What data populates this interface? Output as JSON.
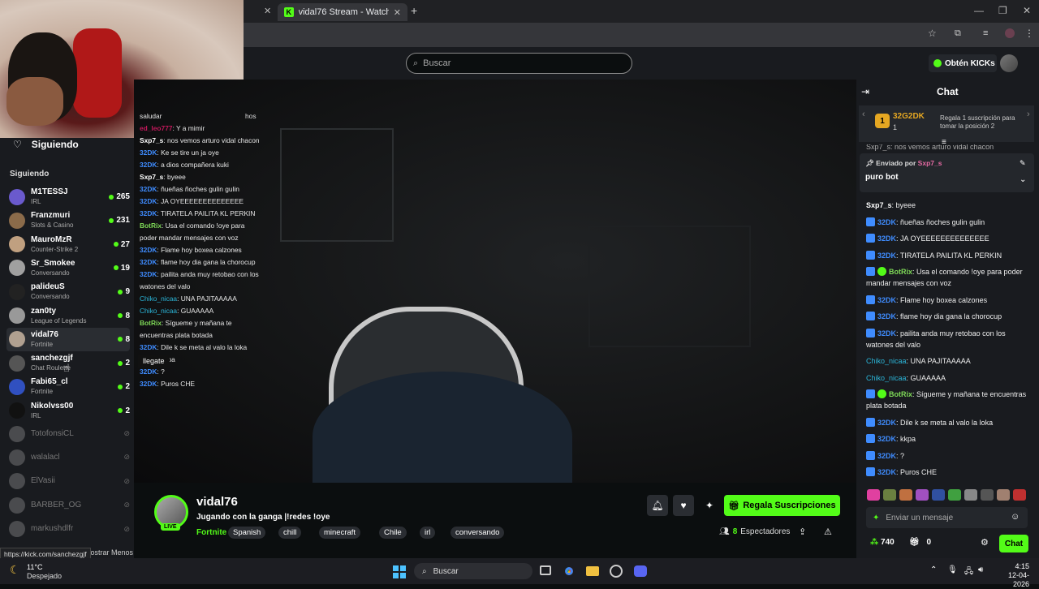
{
  "browser": {
    "tab_title": "vidal76 Stream - Watch Live",
    "status_url": "https://kick.com/sanchezgjf"
  },
  "header": {
    "search_placeholder": "Buscar",
    "kicks_label": "Obtén KICKs"
  },
  "sidebar": {
    "following_title": "Siguiendo",
    "section_label": "Siguiendo",
    "show_less": "Mostrar Menos",
    "channels": [
      {
        "name": "M1TESSJ",
        "category": "IRL",
        "viewers": "265",
        "color": "#6a5acd"
      },
      {
        "name": "Franzmuri",
        "category": "Slots & Casino",
        "viewers": "231",
        "color": "#8b6b4a"
      },
      {
        "name": "MauroMzR",
        "category": "Counter-Strike 2",
        "viewers": "27",
        "color": "#c0a080"
      },
      {
        "name": "Sr_Smokee",
        "category": "Conversando",
        "viewers": "19",
        "color": "#a0a0a0"
      },
      {
        "name": "palideuS",
        "category": "Conversando",
        "viewers": "9",
        "color": "#222"
      },
      {
        "name": "zan0ty",
        "category": "League of Legends",
        "viewers": "8",
        "color": "#999"
      },
      {
        "name": "vidal76",
        "category": "Fortnite",
        "viewers": "8",
        "color": "#b0a090"
      },
      {
        "name": "sanchezgjf",
        "category": "Chat Roulette",
        "viewers": "2",
        "color": "#555"
      },
      {
        "name": "Fabi65_cl",
        "category": "Fortnite",
        "viewers": "2",
        "color": "#3050c0"
      },
      {
        "name": "Nikolvss00",
        "category": "IRL",
        "viewers": "2",
        "color": "#111"
      }
    ],
    "offline_channels": [
      "TotofonsiCL",
      "walalacl",
      "ElVasii",
      "BARBER_OG",
      "markushdlfr"
    ]
  },
  "overlay_chat": {
    "top_fragment": "hos",
    "lines": [
      {
        "user": "",
        "text": "saludar",
        "cls": ""
      },
      {
        "user": "ed_leo777",
        "text": ": Y a mimir",
        "cls": "u-red"
      },
      {
        "user": "Sxp7_s",
        "text": ": nos vemos arturo vidal chacon",
        "cls": "u-white"
      },
      {
        "user": "32DK",
        "text": ": Ke se tire un ja oye",
        "cls": "u-blue"
      },
      {
        "user": "32DK",
        "text": ": a dios compañera kuki",
        "cls": "u-blue"
      },
      {
        "user": "Sxp7_s",
        "text": ": byeee",
        "cls": "u-white"
      },
      {
        "user": "32DK",
        "text": ": ñueñas ñoches gulin gulin",
        "cls": "u-blue"
      },
      {
        "user": "32DK",
        "text": ": JA OYEEEEEEEEEEEEEE",
        "cls": "u-blue"
      },
      {
        "user": "32DK",
        "text": ": TIRATELA PAILITA KL PERKIN",
        "cls": "u-blue"
      },
      {
        "user": "BotRix",
        "text": ": Usa el comando !oye para poder mandar mensajes con voz",
        "cls": "u-green"
      },
      {
        "user": "32DK",
        "text": ": Flame hoy boxea calzones",
        "cls": "u-blue"
      },
      {
        "user": "32DK",
        "text": ": flame hoy dia gana la chorocup",
        "cls": "u-blue"
      },
      {
        "user": "32DK",
        "text": ": pailita anda muy retobao con los watones del valo",
        "cls": "u-blue"
      },
      {
        "user": "Chiko_nicaa",
        "text": ": UNA PAJITAAAAA",
        "cls": "u-cyan"
      },
      {
        "user": "Chiko_nicaa",
        "text": ": GUAAAAA",
        "cls": "u-cyan"
      },
      {
        "user": "BotRix",
        "text": ": Sígueme y mañana te encuentras plata botada",
        "cls": "u-green"
      },
      {
        "user": "32DK",
        "text": ": Dile k se meta al valo la loka",
        "cls": "u-blue"
      },
      {
        "user": "32DK",
        "text": ": kkpa",
        "cls": "u-blue"
      },
      {
        "user": "32DK",
        "text": ": ?",
        "cls": "u-blue"
      },
      {
        "user": "32DK",
        "text": ": Puros CHE",
        "cls": "u-blue"
      }
    ],
    "tooltip": "llegate"
  },
  "stream": {
    "streamer": "vidal76",
    "live_label": "LIVE",
    "title": "Jugando con la ganga |!redes !oye",
    "category": "Fortnite",
    "tags": [
      "Spanish",
      "chill",
      "minecraft",
      "Chile",
      "irl",
      "conversando"
    ],
    "subscribe_label": "Regala Suscripciones",
    "viewer_count": "8",
    "viewer_label": "Espectadores"
  },
  "chat": {
    "title": "Chat",
    "leader_rank": "1",
    "leader_name": "32G2DK",
    "leader_count": "1",
    "leader_note": "Regala 1 suscripción para tomar la posición 2",
    "top_fragment": "Sxp7_s: nos vemos arturo vidal chacon",
    "pinned_prefix": "Enviado por",
    "pinned_user": "Sxp7_s",
    "pinned_message": "puro bot",
    "messages": [
      {
        "user": "Sxp7_s",
        "text": ": byeee",
        "cls": "u-white",
        "badge": ""
      },
      {
        "user": "32DK",
        "text": ": ñueñas ñoches gulin gulin",
        "cls": "u-blue",
        "badge": "sub"
      },
      {
        "user": "32DK",
        "text": ": JA OYEEEEEEEEEEEEEE",
        "cls": "u-blue",
        "badge": "sub"
      },
      {
        "user": "32DK",
        "text": ": TIRATELA PAILITA KL PERKIN",
        "cls": "u-blue",
        "badge": "sub"
      },
      {
        "user": "BotRix",
        "text": ": Usa el comando !oye para poder mandar mensajes con voz",
        "cls": "u-green",
        "badge": "bot"
      },
      {
        "user": "32DK",
        "text": ": Flame hoy boxea calzones",
        "cls": "u-blue",
        "badge": "sub"
      },
      {
        "user": "32DK",
        "text": ": flame hoy dia gana la chorocup",
        "cls": "u-blue",
        "badge": "sub"
      },
      {
        "user": "32DK",
        "text": ": pailita anda muy retobao con los watones del valo",
        "cls": "u-blue",
        "badge": "sub"
      },
      {
        "user": "Chiko_nicaa",
        "text": ": UNA PAJITAAAAA",
        "cls": "u-cyan",
        "badge": ""
      },
      {
        "user": "Chiko_nicaa",
        "text": ": GUAAAAA",
        "cls": "u-cyan",
        "badge": ""
      },
      {
        "user": "BotRix",
        "text": ": Sígueme y mañana te encuentras plata botada",
        "cls": "u-green",
        "badge": "bot"
      },
      {
        "user": "32DK",
        "text": ": Dile k se meta al valo la loka",
        "cls": "u-blue",
        "badge": "sub"
      },
      {
        "user": "32DK",
        "text": ": kkpa",
        "cls": "u-blue",
        "badge": "sub"
      },
      {
        "user": "32DK",
        "text": ": ?",
        "cls": "u-blue",
        "badge": "sub"
      },
      {
        "user": "32DK",
        "text": ": Puros CHE",
        "cls": "u-blue",
        "badge": "sub"
      }
    ],
    "input_placeholder": "Enviar un mensaje",
    "points": "740",
    "gift_count": "0",
    "send_label": "Chat"
  },
  "taskbar": {
    "temperature": "11°C",
    "weather": "Despejado",
    "search_label": "Buscar",
    "time": "4:15",
    "date": "12-04-2026"
  },
  "colors": {
    "brand": "#53fc18",
    "sub": "#3f8cff",
    "leader": "#e5a722"
  }
}
